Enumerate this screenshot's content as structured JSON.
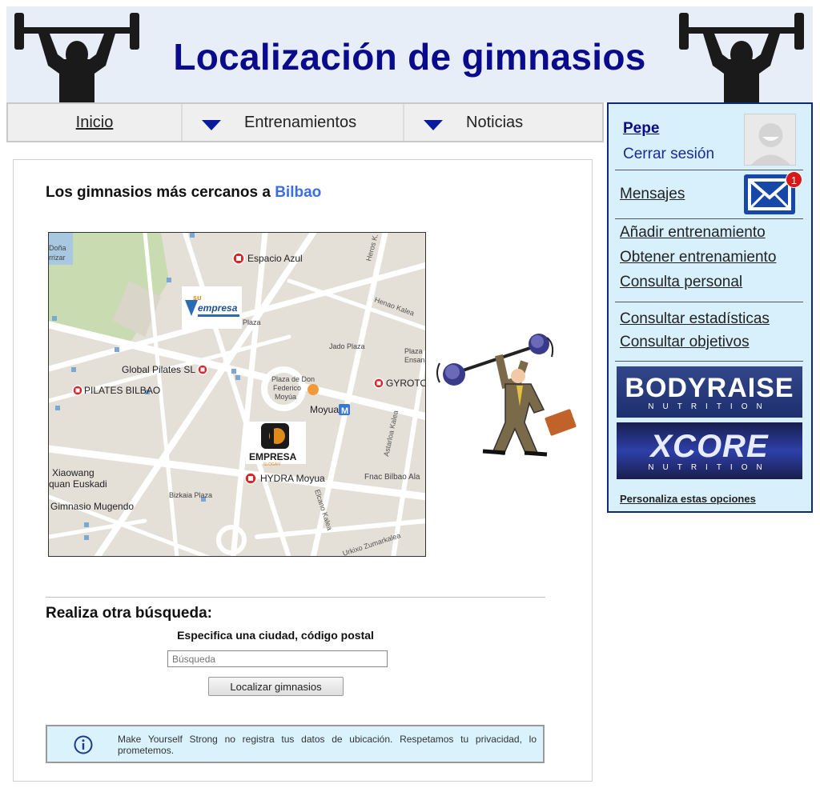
{
  "header": {
    "title": "Localización de gimnasios",
    "logo_icon": "weightlifter-icon"
  },
  "nav": {
    "inicio": "Inicio",
    "entrenamientos": "Entrenamientos",
    "noticias": "Noticias"
  },
  "main": {
    "near_prefix": "Los gimnasios más cercanos a",
    "city": "Bilbao",
    "map": {
      "labels": {
        "espacio_azul": "Espacio Azul",
        "plaza": "Plaza",
        "jado_plaza": "Jado Plaza",
        "global_pilates": "Global Pilates SL",
        "pilates_bilbao": "PILATES BILBAO",
        "plaza_don": "Plaza de Don",
        "federico": "Federico",
        "moyua": "Moyúa",
        "moyua_metro": "Moyua",
        "gyrotonic": "GYROTONIC",
        "hydra": "HYDRA Moyua",
        "xiaowang": "Xiaowang",
        "quan_euskadi": "quan Euskadi",
        "mugendo": "Gimnasio Mugendo",
        "bizkaia_plaza": "Bizkaia Plaza",
        "henao": "Henao Kalea",
        "heros": "Heros K.",
        "elcano": "Elcano Kalea",
        "astarloa": "Astarloa Kalea",
        "fnac": "Fnac Bilbao Ala",
        "zumarkalea": "Urkixo Zumarkalea",
        "plaza_ensanche_1": "Plaza",
        "plaza_ensanche_2": "Ensan",
        "dona": "Doña",
        "arrizar": "rrizar",
        "empresa1": "empresa",
        "empresa1_small": "su",
        "empresa2": "EMPRESA",
        "empresa2_small": "SLOGAN"
      }
    },
    "search_title": "Realiza otra búsqueda:",
    "search_sub": "Especifica una ciudad, código postal",
    "search_placeholder": "Búsqueda",
    "search_button": "Localizar gimnasios",
    "info_text": "Make Yourself Strong no registra tus datos de ubicación. Respetamos tu privacidad, lo prometemos."
  },
  "sidebar": {
    "user": "Pepe",
    "logout": "Cerrar sesión",
    "messages": "Mensajes",
    "messages_count": "1",
    "links_group1": [
      "Añadir entrenamiento",
      "Obtener entrenamiento",
      "Consulta personal"
    ],
    "links_group2": [
      "Consultar estadísticas",
      "Consultar objetivos"
    ],
    "banner1_big": "BODYRAISE",
    "banner1_small": "NUTRITION",
    "banner2_big": "XCORE",
    "banner2_small": "NUTRITION",
    "personaliza": "Personaliza estas opciones"
  },
  "colors": {
    "title": "#0a0a8c",
    "city": "#3a6fe0",
    "sidebar_bg": "#d7f0fb",
    "sidebar_border": "#0b2a7a",
    "info_bg": "#d9f2fb",
    "badge": "#d61818",
    "map_pin": "#d9262a"
  }
}
